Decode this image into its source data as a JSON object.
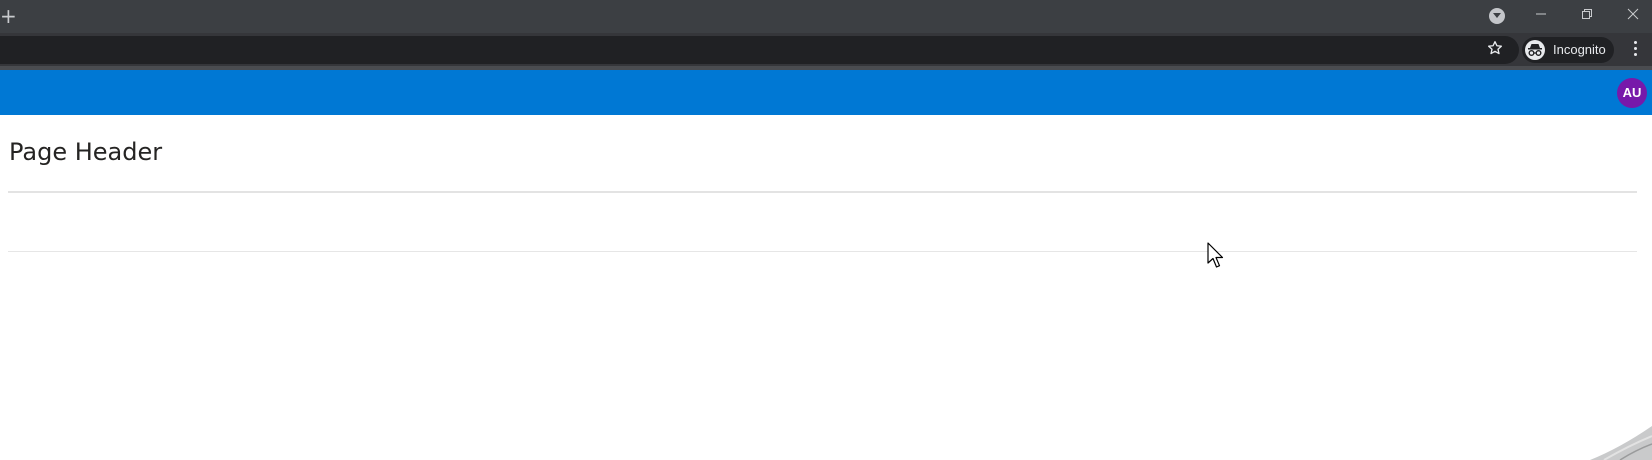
{
  "browser": {
    "new_tab_symbol": "+",
    "profile_label": "Incognito",
    "icons": [
      "new-tab-icon",
      "tab-search-icon",
      "minimize-icon",
      "restore-icon",
      "close-icon",
      "star-icon",
      "incognito-icon",
      "menu-kebab-icon"
    ]
  },
  "app_bar": {
    "color": "#0078d4",
    "user_initials": "AU",
    "avatar_color": "#7719aa"
  },
  "page": {
    "title": "Page Header"
  }
}
